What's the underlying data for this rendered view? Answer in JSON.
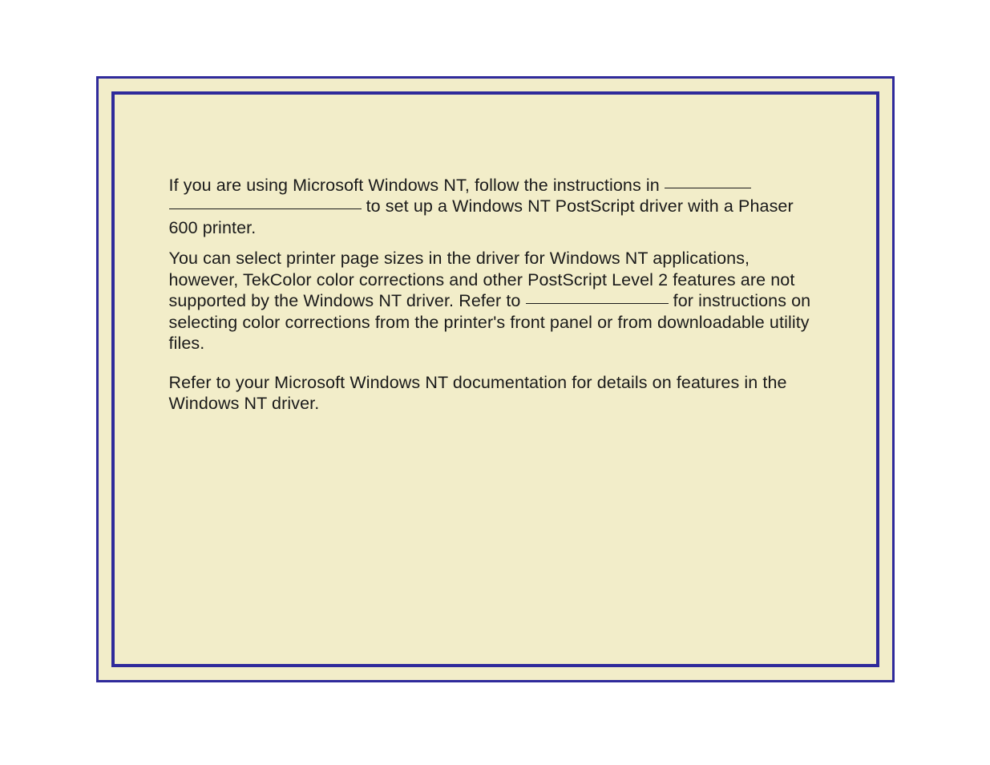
{
  "paragraphs": {
    "p1a": "If you are using Microsoft Windows NT, follow the instructions in ",
    "p1b": " to set up a Windows NT PostScript driver with a Phaser 600 printer.",
    "p2a": "You can select printer page sizes in the driver for Windows NT applications, however, TekColor color corrections and other PostScript Level 2 features are not supported by the Windows NT driver.  Refer to ",
    "p2b": " for instructions on selecting color corrections from the printer's front panel or from downloadable utility files.",
    "p3": "Refer to your Microsoft Windows NT documentation for details on features in the Windows NT driver."
  }
}
